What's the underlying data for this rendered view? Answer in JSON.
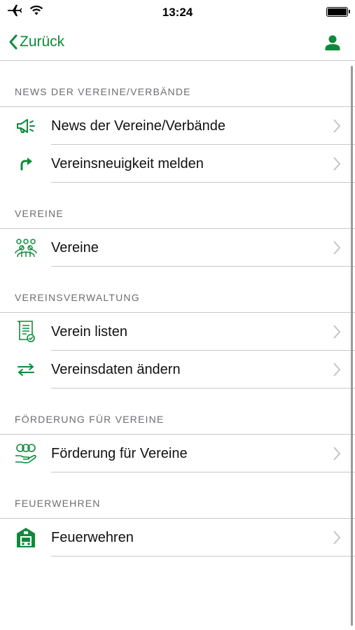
{
  "status_bar": {
    "time": "13:24"
  },
  "nav": {
    "back_label": "Zurück"
  },
  "colors": {
    "accent": "#0f8a3b",
    "section_text": "#6d6d72",
    "separator": "#c8c7cc"
  },
  "sections": [
    {
      "header": "NEWS DER VEREINE/VERBÄNDE",
      "items": [
        {
          "label": "News der Vereine/Verbände",
          "icon": "megaphone-icon"
        },
        {
          "label": "Vereinsneuigkeit melden",
          "icon": "forward-arrow-icon"
        }
      ]
    },
    {
      "header": "VEREINE",
      "items": [
        {
          "label": "Vereine",
          "icon": "group-people-icon"
        }
      ]
    },
    {
      "header": "VEREINSVERWALTUNG",
      "items": [
        {
          "label": "Verein listen",
          "icon": "document-list-icon"
        },
        {
          "label": "Vereinsdaten ändern",
          "icon": "swap-arrows-icon"
        }
      ]
    },
    {
      "header": "FÖRDERUNG FÜR VEREINE",
      "items": [
        {
          "label": "Förderung für Vereine",
          "icon": "money-hand-icon"
        }
      ]
    },
    {
      "header": "FEUERWEHREN",
      "items": [
        {
          "label": "Feuerwehren",
          "icon": "fire-station-icon"
        }
      ]
    }
  ]
}
